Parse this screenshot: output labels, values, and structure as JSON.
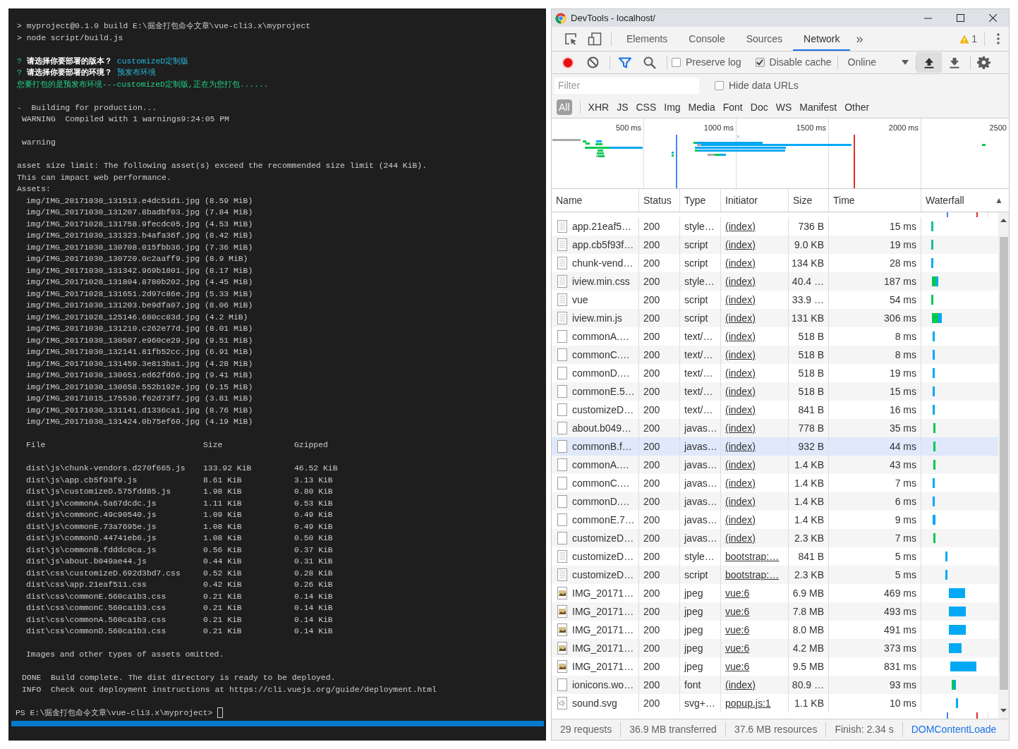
{
  "terminal": {
    "blocks": [
      {
        "kind": "lines",
        "lines": [
          {
            "kind": "command",
            "text": "> myproject@0.1.0 build E:\\掘金打包命令文章\\vue-cli3.x\\myproject"
          },
          {
            "kind": "command",
            "text": "> node script/build.js"
          }
        ]
      },
      {
        "kind": "lines",
        "lines": [
          {
            "kind": "question",
            "mark": "?",
            "question": "请选择你要部署的版本？",
            "answer": "customizeD定制版"
          },
          {
            "kind": "question",
            "mark": "?",
            "question": "请选择你要部署的环境？",
            "answer": "预发布环境"
          },
          {
            "kind": "success",
            "text": "您要打包的是预发布环境---customizeD定制版,正在为您打包......"
          }
        ]
      },
      {
        "kind": "lines",
        "lines": [
          {
            "kind": "text",
            "text": "-  Building for production..."
          },
          {
            "kind": "label",
            "text": "WARNING  Compiled with 1 warnings9:24:05 PM"
          }
        ]
      },
      {
        "kind": "lines",
        "lines": [
          {
            "kind": "label",
            "text": "warning"
          }
        ]
      },
      {
        "kind": "lines",
        "lines": [
          {
            "kind": "text",
            "text": "asset size limit: The following asset(s) exceed the recommended size limit (244 KiB)."
          },
          {
            "kind": "text",
            "text": "This can impact web performance."
          },
          {
            "kind": "text",
            "text": "Assets:"
          },
          {
            "kind": "item",
            "text": "img/IMG_20171030_131513.e4dc51d1.jpg (8.59 MiB)"
          },
          {
            "kind": "item",
            "text": "img/IMG_20171030_131207.8badbf03.jpg (7.84 MiB)"
          },
          {
            "kind": "item",
            "text": "img/IMG_20171028_131758.9fecdc05.jpg (4.53 MiB)"
          },
          {
            "kind": "item",
            "text": "img/IMG_20171030_131323.b4afa36f.jpg (8.42 MiB)"
          },
          {
            "kind": "item",
            "text": "img/IMG_20171030_130708.015fbb36.jpg (7.36 MiB)"
          },
          {
            "kind": "item",
            "text": "img/IMG_20171030_130720.0c2aaff9.jpg (8.9 MiB)"
          },
          {
            "kind": "item",
            "text": "img/IMG_20171030_131342.969b1801.jpg (8.17 MiB)"
          },
          {
            "kind": "item",
            "text": "img/IMG_20171028_131804.8780b202.jpg (4.45 MiB)"
          },
          {
            "kind": "item",
            "text": "img/IMG_20171028_131651.2d97c86e.jpg (5.33 MiB)"
          },
          {
            "kind": "item",
            "text": "img/IMG_20171030_131203.be9dfa07.jpg (8.06 MiB)"
          },
          {
            "kind": "item",
            "text": "img/IMG_20171028_125146.680cc83d.jpg (4.2 MiB)"
          },
          {
            "kind": "item",
            "text": "img/IMG_20171030_131210.c262e77d.jpg (8.01 MiB)"
          },
          {
            "kind": "item",
            "text": "img/IMG_20171030_130507.e960ce29.jpg (9.51 MiB)"
          },
          {
            "kind": "item",
            "text": "img/IMG_20171030_132141.81fb52cc.jpg (6.91 MiB)"
          },
          {
            "kind": "item",
            "text": "img/IMG_20171030_131459.3e813ba1.jpg (4.28 MiB)"
          },
          {
            "kind": "item",
            "text": "img/IMG_20171030_130651.ed62fd66.jpg (9.41 MiB)"
          },
          {
            "kind": "item",
            "text": "img/IMG_20171030_130658.552b192e.jpg (9.15 MiB)"
          },
          {
            "kind": "item",
            "text": "img/IMG_20171015_175536.f62d73f7.jpg (3.81 MiB)"
          },
          {
            "kind": "item",
            "text": "img/IMG_20171030_131141.d1336ca1.jpg (8.76 MiB)"
          },
          {
            "kind": "item",
            "text": "img/IMG_20171030_131424.0b75ef60.jpg (4.19 MiB)"
          }
        ]
      },
      {
        "kind": "table",
        "columns": [
          "File",
          "Size",
          "Gzipped"
        ],
        "rows": [
          [
            "dist\\js\\chunk-vendors.d270f665.js",
            "133.92 KiB",
            "46.52 KiB"
          ],
          [
            "dist\\js\\app.cb5f93f9.js",
            "8.61 KiB",
            "3.13 KiB"
          ],
          [
            "dist\\js\\customizeD.575fdd85.js",
            "1.98 KiB",
            "0.80 KiB"
          ],
          [
            "dist\\js\\commonA.5a67dcdc.js",
            "1.11 KiB",
            "0.53 KiB"
          ],
          [
            "dist\\js\\commonC.49c90540.js",
            "1.09 KiB",
            "0.49 KiB"
          ],
          [
            "dist\\js\\commonE.73a7695e.js",
            "1.08 KiB",
            "0.49 KiB"
          ],
          [
            "dist\\js\\commonD.44741eb6.js",
            "1.08 KiB",
            "0.50 KiB"
          ],
          [
            "dist\\js\\commonB.fdddc0ca.js",
            "0.56 KiB",
            "0.37 KiB"
          ],
          [
            "dist\\js\\about.b049ae44.js",
            "0.44 KiB",
            "0.31 KiB"
          ],
          [
            "dist\\css\\customizeD.692d3bd7.css",
            "0.52 KiB",
            "0.28 KiB"
          ],
          [
            "dist\\css\\app.21eaf511.css",
            "0.42 KiB",
            "0.26 KiB"
          ],
          [
            "dist\\css\\commonE.560ca1b3.css",
            "0.21 KiB",
            "0.14 KiB"
          ],
          [
            "dist\\css\\commonC.560ca1b3.css",
            "0.21 KiB",
            "0.14 KiB"
          ],
          [
            "dist\\css\\commonA.560ca1b3.css",
            "0.21 KiB",
            "0.14 KiB"
          ],
          [
            "dist\\css\\commonD.560ca1b3.css",
            "0.21 KiB",
            "0.14 KiB"
          ]
        ]
      },
      {
        "kind": "lines",
        "lines": [
          {
            "kind": "item",
            "text": "Images and other types of assets omitted."
          }
        ]
      },
      {
        "kind": "lines",
        "lines": [
          {
            "kind": "label",
            "text": "DONE  Build complete. The dist directory is ready to be deployed."
          },
          {
            "kind": "label",
            "text": "INFO  Check out deployment instructions at https://cli.vuejs.org/guide/deployment.html"
          }
        ]
      },
      {
        "kind": "lines",
        "lines": [
          {
            "kind": "prompt",
            "text": "PS E:\\掘金打包命令文章\\vue-cli3.x\\myproject>"
          }
        ]
      }
    ]
  },
  "devtools": {
    "title": "DevTools - localhost/",
    "panel_tabs": [
      {
        "label": "Elements",
        "selected": false
      },
      {
        "label": "Console",
        "selected": false
      },
      {
        "label": "Sources",
        "selected": false
      },
      {
        "label": "Network",
        "selected": true
      }
    ],
    "more_tabs": "»",
    "warning_count": "1",
    "recording": true,
    "filter_active": true,
    "checkboxes": [
      {
        "label": "Preserve log",
        "checked": false
      },
      {
        "label": "Disable cache",
        "checked": true
      }
    ],
    "throttling": "Online",
    "filter": {
      "placeholder": "Filter"
    },
    "hide_data_urls": {
      "label": "Hide data URLs",
      "checked": false
    },
    "type_filters": [
      {
        "label": "All",
        "selected": true
      },
      {
        "label": "XHR",
        "selected": false
      },
      {
        "label": "JS",
        "selected": false
      },
      {
        "label": "CSS",
        "selected": false
      },
      {
        "label": "Img",
        "selected": false
      },
      {
        "label": "Media",
        "selected": false
      },
      {
        "label": "Font",
        "selected": false
      },
      {
        "label": "Doc",
        "selected": false
      },
      {
        "label": "WS",
        "selected": false
      },
      {
        "label": "Manifest",
        "selected": false
      },
      {
        "label": "Other",
        "selected": false
      }
    ],
    "overview_ticks": [
      "500 ms",
      "1000 ms",
      "1500 ms",
      "2000 ms",
      "2500"
    ],
    "columns": [
      {
        "label": "Name"
      },
      {
        "label": "Status"
      },
      {
        "label": "Type"
      },
      {
        "label": "Initiator"
      },
      {
        "label": "Size"
      },
      {
        "label": "Time"
      },
      {
        "label": "Waterfall",
        "sort_indicator": "▲"
      }
    ],
    "rows": [
      {
        "kind": "document",
        "name": "app.21eaf5…",
        "status": "200",
        "type": "style…",
        "initiator": "(index)",
        "size": "736 B",
        "time": "15 ms",
        "hovered": false
      },
      {
        "kind": "document",
        "name": "app.cb5f93f…",
        "status": "200",
        "type": "script",
        "initiator": "(index)",
        "size": "9.0 KB",
        "time": "19 ms",
        "hovered": false
      },
      {
        "kind": "document",
        "name": "chunk-vend…",
        "status": "200",
        "type": "script",
        "initiator": "(index)",
        "size": "134 KB",
        "time": "28 ms",
        "hovered": false
      },
      {
        "kind": "document",
        "name": "iview.min.css",
        "status": "200",
        "type": "style…",
        "initiator": "(index)",
        "size": "40.4 …",
        "time": "187 ms",
        "hovered": false
      },
      {
        "kind": "document",
        "name": "vue",
        "status": "200",
        "type": "script",
        "initiator": "(index)",
        "size": "33.9 …",
        "time": "54 ms",
        "hovered": false
      },
      {
        "kind": "document",
        "name": "iview.min.js",
        "status": "200",
        "type": "script",
        "initiator": "(index)",
        "size": "131 KB",
        "time": "306 ms",
        "hovered": false
      },
      {
        "kind": "file",
        "name": "commonA.…",
        "status": "200",
        "type": "text/…",
        "initiator": "(index)",
        "size": "518 B",
        "time": "8 ms",
        "hovered": false
      },
      {
        "kind": "file",
        "name": "commonC.…",
        "status": "200",
        "type": "text/…",
        "initiator": "(index)",
        "size": "518 B",
        "time": "8 ms",
        "hovered": false
      },
      {
        "kind": "file",
        "name": "commonD.…",
        "status": "200",
        "type": "text/…",
        "initiator": "(index)",
        "size": "518 B",
        "time": "19 ms",
        "hovered": false
      },
      {
        "kind": "file",
        "name": "commonE.5…",
        "status": "200",
        "type": "text/…",
        "initiator": "(index)",
        "size": "518 B",
        "time": "15 ms",
        "hovered": false
      },
      {
        "kind": "file",
        "name": "customizeD…",
        "status": "200",
        "type": "text/…",
        "initiator": "(index)",
        "size": "841 B",
        "time": "16 ms",
        "hovered": false
      },
      {
        "kind": "file",
        "name": "about.b049…",
        "status": "200",
        "type": "javas…",
        "initiator": "(index)",
        "size": "778 B",
        "time": "35 ms",
        "hovered": false
      },
      {
        "kind": "file",
        "name": "commonB.f…",
        "status": "200",
        "type": "javas…",
        "initiator": "(index)",
        "size": "932 B",
        "time": "44 ms",
        "hovered": true
      },
      {
        "kind": "file",
        "name": "commonA.…",
        "status": "200",
        "type": "javas…",
        "initiator": "(index)",
        "size": "1.4 KB",
        "time": "43 ms",
        "hovered": false
      },
      {
        "kind": "file",
        "name": "commonC.…",
        "status": "200",
        "type": "javas…",
        "initiator": "(index)",
        "size": "1.4 KB",
        "time": "7 ms",
        "hovered": false
      },
      {
        "kind": "file",
        "name": "commonD.…",
        "status": "200",
        "type": "javas…",
        "initiator": "(index)",
        "size": "1.4 KB",
        "time": "6 ms",
        "hovered": false
      },
      {
        "kind": "file",
        "name": "commonE.7…",
        "status": "200",
        "type": "javas…",
        "initiator": "(index)",
        "size": "1.4 KB",
        "time": "9 ms",
        "hovered": false
      },
      {
        "kind": "file",
        "name": "customizeD…",
        "status": "200",
        "type": "javas…",
        "initiator": "(index)",
        "size": "2.3 KB",
        "time": "7 ms",
        "hovered": false
      },
      {
        "kind": "document",
        "name": "customizeD…",
        "status": "200",
        "type": "style…",
        "initiator": "bootstrap:…",
        "size": "841 B",
        "time": "5 ms",
        "hovered": false
      },
      {
        "kind": "document",
        "name": "customizeD…",
        "status": "200",
        "type": "script",
        "initiator": "bootstrap:…",
        "size": "2.3 KB",
        "time": "5 ms",
        "hovered": false
      },
      {
        "kind": "image",
        "name": "IMG_20171…",
        "status": "200",
        "type": "jpeg",
        "initiator": "vue:6",
        "size": "6.9 MB",
        "time": "469 ms",
        "hovered": false
      },
      {
        "kind": "image",
        "name": "IMG_20171…",
        "status": "200",
        "type": "jpeg",
        "initiator": "vue:6",
        "size": "7.8 MB",
        "time": "493 ms",
        "hovered": false
      },
      {
        "kind": "image",
        "name": "IMG_20171…",
        "status": "200",
        "type": "jpeg",
        "initiator": "vue:6",
        "size": "8.0 MB",
        "time": "491 ms",
        "hovered": false
      },
      {
        "kind": "image",
        "name": "IMG_20171…",
        "status": "200",
        "type": "jpeg",
        "initiator": "vue:6",
        "size": "4.2 MB",
        "time": "373 ms",
        "hovered": false
      },
      {
        "kind": "image",
        "name": "IMG_20171…",
        "status": "200",
        "type": "jpeg",
        "initiator": "vue:6",
        "size": "9.5 MB",
        "time": "831 ms",
        "hovered": false
      },
      {
        "kind": "file",
        "name": "ionicons.wo…",
        "status": "200",
        "type": "font",
        "initiator": "(index)",
        "size": "80.9 …",
        "time": "93 ms",
        "hovered": false
      },
      {
        "kind": "sound",
        "name": "sound.svg",
        "status": "200",
        "type": "svg+…",
        "initiator": "popup.js:1",
        "size": "1.1 KB",
        "time": "10 ms",
        "hovered": false
      }
    ],
    "summary": [
      {
        "kind": "stat",
        "text": "29 requests"
      },
      {
        "kind": "stat",
        "text": "36.9 MB transferred"
      },
      {
        "kind": "stat",
        "text": "37.6 MB resources"
      },
      {
        "kind": "stat",
        "text": "Finish: 2.34 s"
      },
      {
        "kind": "event",
        "text": "DOMContentLoade"
      }
    ]
  }
}
